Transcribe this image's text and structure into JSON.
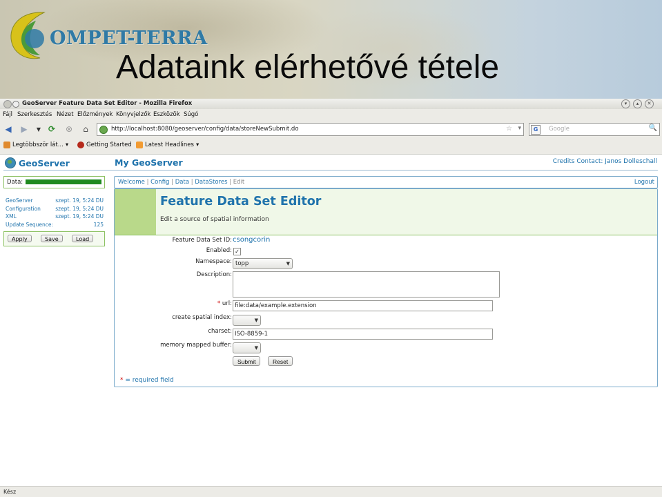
{
  "slide": {
    "logo_text": "OMPET-TERRA",
    "title": "Adataink elérhetővé tétele"
  },
  "browser": {
    "window_title": "GeoServer Feature Data Set Editor - Mozilla Firefox",
    "menu": [
      "Fájl",
      "Szerkesztés",
      "Nézet",
      "Előzmények",
      "Könyvjelzők",
      "Eszközök",
      "Súgó"
    ],
    "url": "http://localhost:8080/geoserver/config/data/storeNewSubmit.do",
    "search_placeholder": "Google",
    "bookmarks": [
      "Legtöbbször lát...",
      "Getting Started",
      "Latest Headlines"
    ],
    "status": "Kész"
  },
  "page": {
    "logo": "GeoServer",
    "heading": "My GeoServer",
    "credits": "Credits",
    "contact": "Contact: Janos Dolleschall",
    "data_label": "Data:",
    "data_fill": 1.0,
    "status_rows": [
      {
        "key": "GeoServer",
        "value": "szept. 19, 5:24 DU"
      },
      {
        "key": "Configuration",
        "value": "szept. 19, 5:24 DU"
      },
      {
        "key": "XML",
        "value": "szept. 19, 5:24 DU"
      },
      {
        "key": "Update Sequence:",
        "value": "125"
      }
    ],
    "side_buttons": [
      "Apply",
      "Save",
      "Load"
    ],
    "breadcrumb": [
      "Welcome",
      "Config",
      "Data",
      "DataStores",
      "Edit"
    ],
    "logout": "Logout",
    "editor_title": "Feature Data Set Editor",
    "editor_subtitle": "Edit a source of spatial information",
    "form": {
      "id_label": "Feature Data Set ID:",
      "id_value": "csongcorin",
      "enabled_label": "Enabled:",
      "enabled_checked": true,
      "namespace_label": "Namespace:",
      "namespace_value": "topp",
      "description_label": "Description:",
      "description_value": "",
      "url_label": "url:",
      "url_req": "*",
      "url_value": "file:data/example.extension",
      "spatial_index_label": "create spatial index:",
      "spatial_index_value": "",
      "charset_label": "charset:",
      "charset_value": "ISO-8859-1",
      "mmb_label": "memory mapped buffer:",
      "mmb_value": "",
      "submit": "Submit",
      "reset": "Reset"
    },
    "required_star": "*",
    "required_note": "= required field"
  }
}
